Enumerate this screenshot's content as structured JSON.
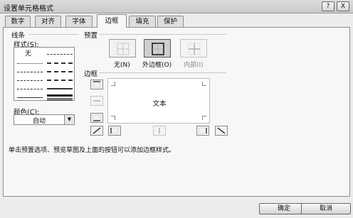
{
  "window": {
    "title": "设置单元格格式",
    "help_label": "?",
    "close_label": "X"
  },
  "tabs": [
    {
      "label": "数字"
    },
    {
      "label": "对齐"
    },
    {
      "label": "字体"
    },
    {
      "label": "边框",
      "active": true
    },
    {
      "label": "填充"
    },
    {
      "label": "保护"
    }
  ],
  "line_section": {
    "title": "线条",
    "style_label": "样式(S):",
    "none_label": "无",
    "color_label": "颜色(C):",
    "color_value": "自动"
  },
  "presets_section": {
    "title": "预置",
    "items": [
      {
        "label": "无(N)"
      },
      {
        "label": "外边框(O)"
      },
      {
        "label": "内部(I)"
      }
    ]
  },
  "border_section": {
    "title": "边框",
    "preview_text": "文本"
  },
  "hint": "单击预置选项、预览草图及上面的按钮可以添加边框样式。",
  "buttons": {
    "ok": "确定",
    "cancel": "取消"
  },
  "colors": {
    "selected_preset": "#cfcfcf",
    "panel_bg": "#f7f7f7"
  }
}
